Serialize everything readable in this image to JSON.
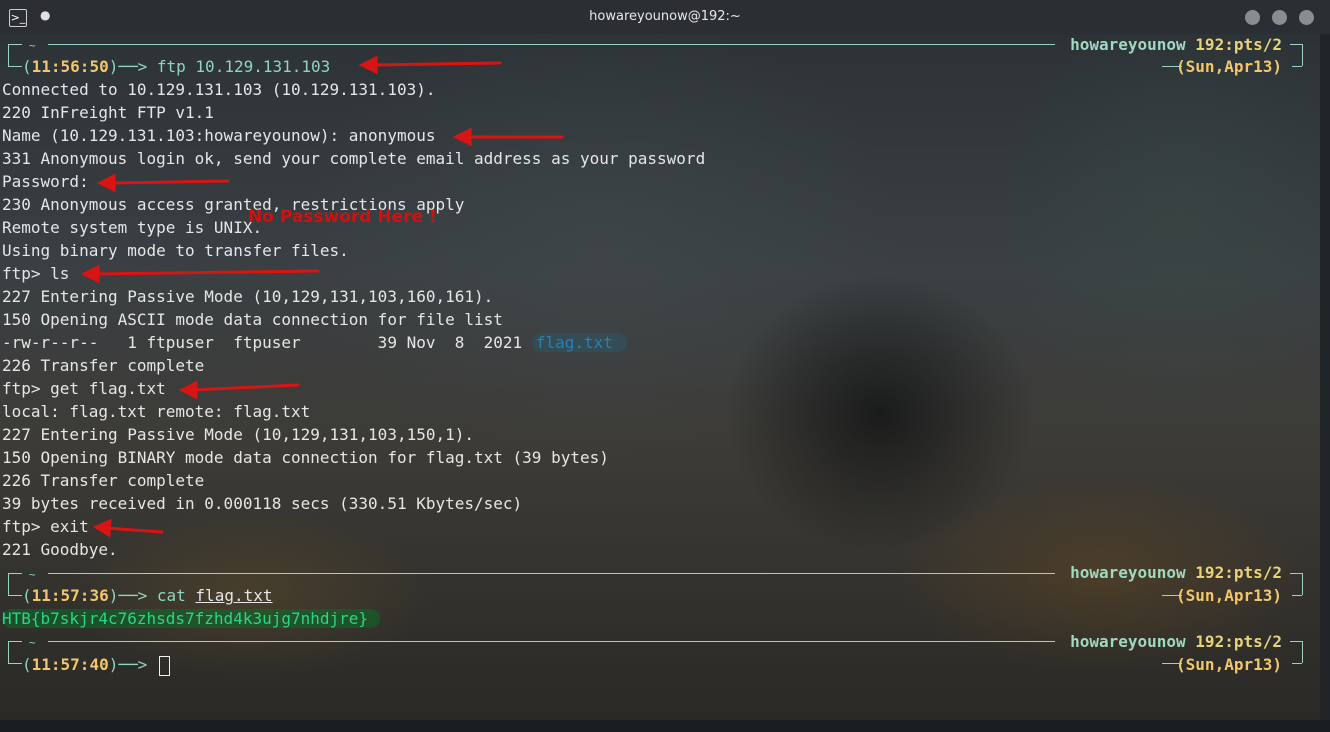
{
  "window": {
    "title": "howareyounow@192:~",
    "app_icon": "konsole-icon",
    "pin": "●"
  },
  "prompt": {
    "tilde": "~",
    "user": "howareyounow",
    "host": "192:pts/2",
    "date": "(Sun,Apr13)",
    "arrow": "──>"
  },
  "blocks": [
    {
      "time": "11:56:50",
      "command": "ftp 10.129.131.103"
    },
    {
      "time": "11:57:36",
      "command_prefix": "cat ",
      "command_arg": "flag.txt"
    },
    {
      "time": "11:57:40"
    }
  ],
  "output": [
    "Connected to 10.129.131.103 (10.129.131.103).",
    "220 InFreight FTP v1.1",
    "Name (10.129.131.103:howareyounow): anonymous",
    "331 Anonymous login ok, send your complete email address as your password",
    "Password:",
    "230 Anonymous access granted, restrictions apply",
    "Remote system type is UNIX.",
    "Using binary mode to transfer files.",
    "ftp> ls",
    "227 Entering Passive Mode (10,129,131,103,160,161).",
    "150 Opening ASCII mode data connection for file list",
    "-rw-r--r--   1 ftpuser  ftpuser        39 Nov  8  2021 ",
    "226 Transfer complete",
    "ftp> get flag.txt",
    "local: flag.txt remote: flag.txt",
    "227 Entering Passive Mode (10,129,131,103,150,1).",
    "150 Opening BINARY mode data connection for flag.txt (39 bytes)",
    "226 Transfer complete",
    "39 bytes received in 0.000118 secs (330.51 Kbytes/sec)",
    "ftp> exit",
    "221 Goodbye."
  ],
  "listing_file": "flag.txt",
  "flag": "HTB{b7skjr4c76zhsds7fzhd4k3ujg7nhdjre}",
  "annotation": "No Password Here !",
  "colors": {
    "arrow": "#d81414",
    "frame": "#9bd3c3",
    "time": "#f2c66b",
    "flag_bg": "#0a6e28"
  }
}
